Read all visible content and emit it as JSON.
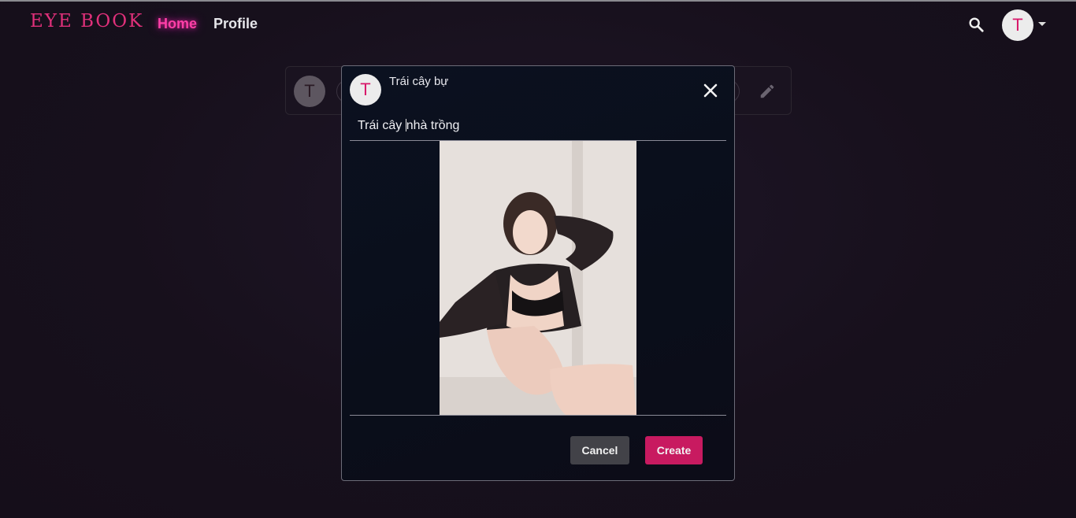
{
  "nav": {
    "logo": "EYE BOOK",
    "links": [
      {
        "label": "Home",
        "active": true
      },
      {
        "label": "Profile",
        "active": false
      }
    ],
    "search_icon": "search-icon",
    "avatar_initial": "T"
  },
  "composer": {
    "avatar_initial": "T",
    "edit_icon": "pencil-icon"
  },
  "dialog": {
    "avatar_initial": "T",
    "user_name": "Trái cây bự",
    "close_icon": "close-icon",
    "caption_before_cursor": "Trái cây ",
    "caption_after_cursor": "nhà trồng",
    "cancel_label": "Cancel",
    "create_label": "Create"
  },
  "colors": {
    "accent": "#c81a60",
    "logo": "#e0307a",
    "active_link": "#ff3fa8",
    "background": "#1a1220",
    "dialog_bg": "#0b1120"
  }
}
